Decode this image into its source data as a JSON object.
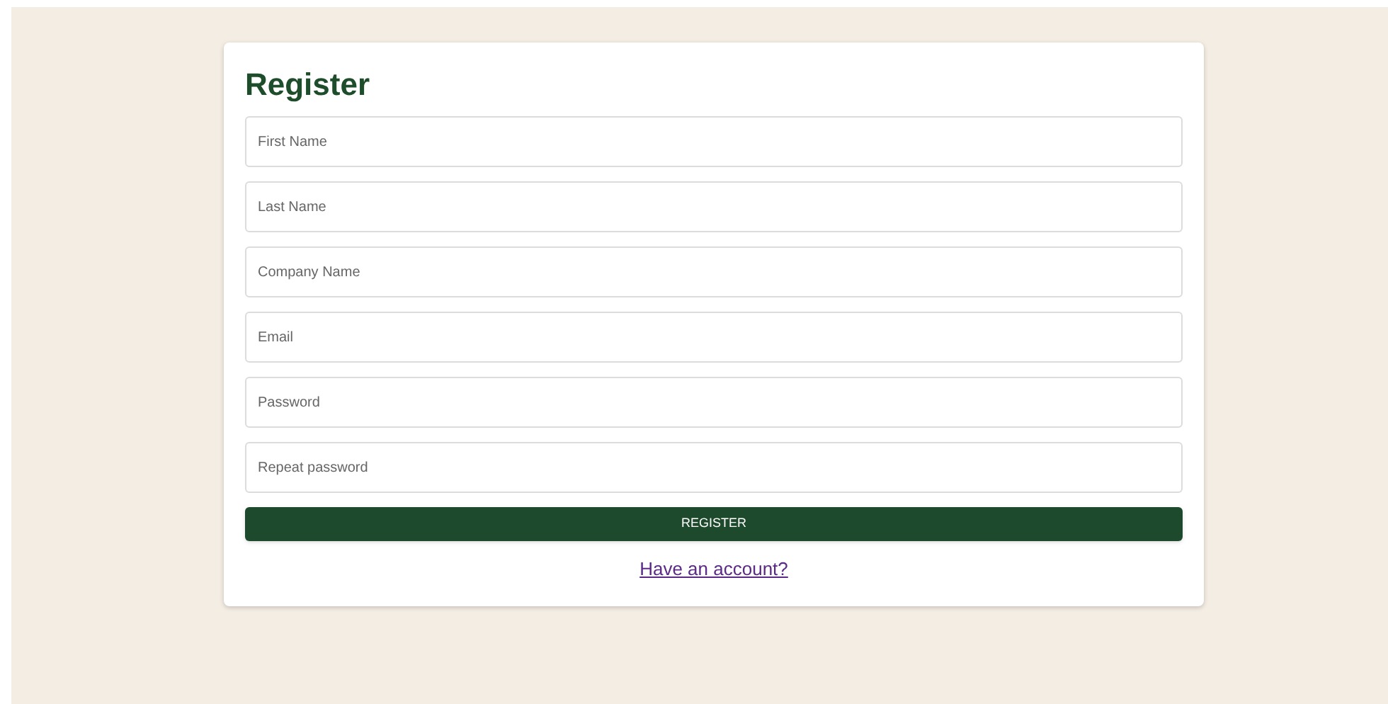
{
  "form": {
    "title": "Register",
    "fields": [
      {
        "placeholder": "First Name"
      },
      {
        "placeholder": "Last Name"
      },
      {
        "placeholder": "Company Name"
      },
      {
        "placeholder": "Email"
      },
      {
        "placeholder": "Password"
      },
      {
        "placeholder": "Repeat password"
      }
    ],
    "submit_button": "REGISTER",
    "login_link": "Have an account?"
  }
}
